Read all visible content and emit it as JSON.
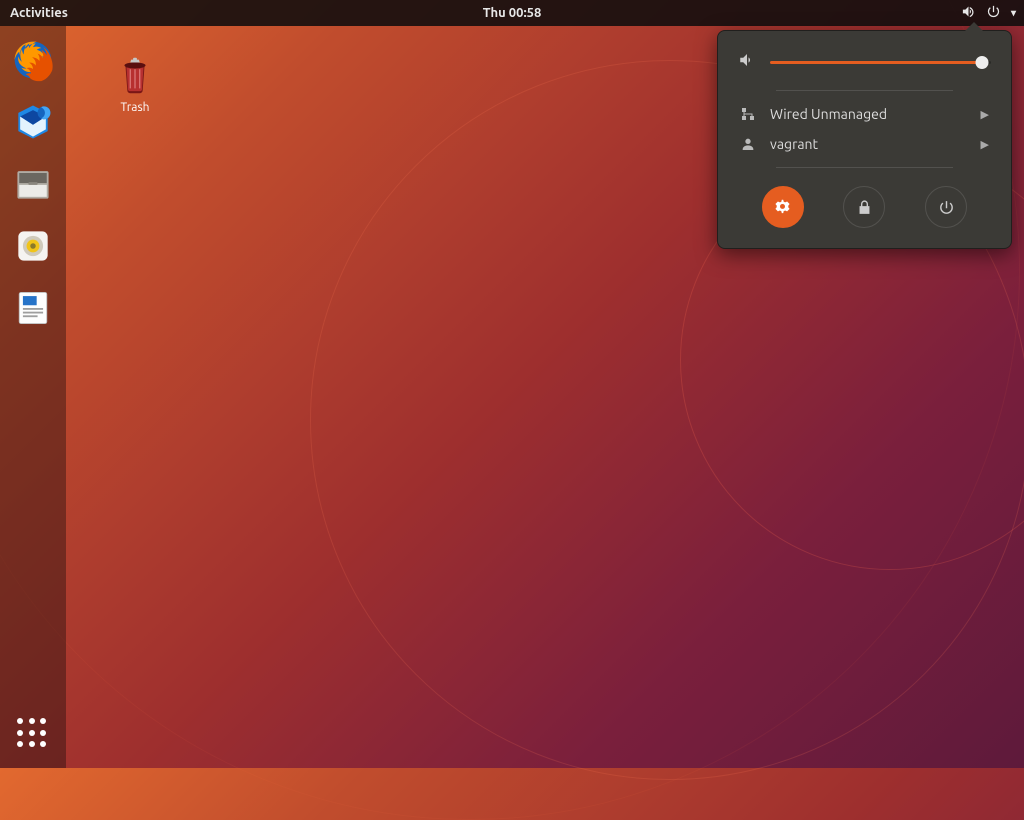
{
  "topbar": {
    "activities": "Activities",
    "clock": "Thu 00:58"
  },
  "desktop": {
    "trash_label": "Trash"
  },
  "system_menu": {
    "volume_percent": 96,
    "network_label": "Wired Unmanaged",
    "user_label": "vagrant"
  },
  "colors": {
    "accent": "#e55d20"
  }
}
